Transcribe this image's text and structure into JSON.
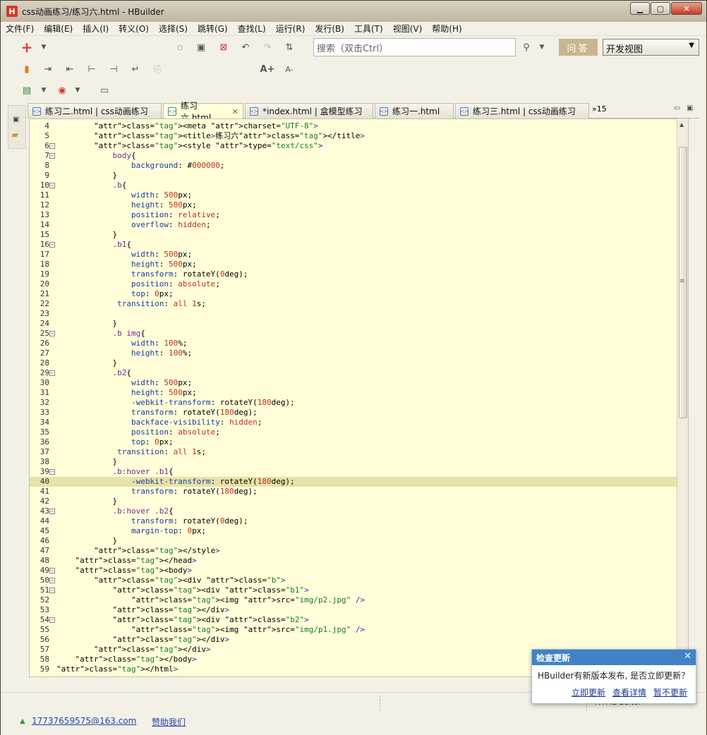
{
  "window": {
    "title": "css动画练习/练习六.html  -  HBuilder",
    "icon_letter": "H"
  },
  "menu": [
    "文件(F)",
    "编辑(E)",
    "插入(I)",
    "转义(O)",
    "选择(S)",
    "跳转(G)",
    "查找(L)",
    "运行(R)",
    "发行(B)",
    "工具(T)",
    "视图(V)",
    "帮助(H)"
  ],
  "toolbar": {
    "search_placeholder": "搜索（双击Ctrl）",
    "ask_label": "问答",
    "view_select": "开发视图",
    "font_increase": "A+",
    "font_decrease": "A-"
  },
  "tabs": [
    {
      "label": "练习二.html | css动画练习",
      "active": false
    },
    {
      "label": "练习六.html",
      "active": true
    },
    {
      "label": "*index.html | 盒模型练习",
      "active": false
    },
    {
      "label": "练习一.html",
      "active": false
    },
    {
      "label": "练习三.html | css动画练习",
      "active": false
    }
  ],
  "tabs_overflow": "»15",
  "editor": {
    "current_line": 40,
    "lines": [
      {
        "n": 4,
        "code": "        <meta charset=\"UTF-8\">"
      },
      {
        "n": 5,
        "code": "        <title>练习六</title>"
      },
      {
        "n": 6,
        "code": "        <style type=\"text/css\">",
        "fold": true
      },
      {
        "n": 7,
        "code": "            body{",
        "fold": true
      },
      {
        "n": 8,
        "code": "                background: #000000;"
      },
      {
        "n": 9,
        "code": "            }"
      },
      {
        "n": 10,
        "code": "            .b{",
        "fold": true
      },
      {
        "n": 11,
        "code": "                width: 500px;"
      },
      {
        "n": 12,
        "code": "                height: 500px;"
      },
      {
        "n": 13,
        "code": "                position: relative;"
      },
      {
        "n": 14,
        "code": "                overflow: hidden;"
      },
      {
        "n": 15,
        "code": "            }"
      },
      {
        "n": 16,
        "code": "            .b1{",
        "fold": true
      },
      {
        "n": 17,
        "code": "                width: 500px;"
      },
      {
        "n": 18,
        "code": "                height: 500px;"
      },
      {
        "n": 19,
        "code": "                transform: rotateY(0deg);"
      },
      {
        "n": 20,
        "code": "                position: absolute;"
      },
      {
        "n": 21,
        "code": "                top: 0px;"
      },
      {
        "n": 22,
        "code": "             transition: all 1s;"
      },
      {
        "n": 23,
        "code": ""
      },
      {
        "n": 24,
        "code": "            }"
      },
      {
        "n": 25,
        "code": "            .b img{",
        "fold": true
      },
      {
        "n": 26,
        "code": "                width: 100%;"
      },
      {
        "n": 27,
        "code": "                height: 100%;"
      },
      {
        "n": 28,
        "code": "            }"
      },
      {
        "n": 29,
        "code": "            .b2{",
        "fold": true
      },
      {
        "n": 30,
        "code": "                width: 500px;"
      },
      {
        "n": 31,
        "code": "                height: 500px;"
      },
      {
        "n": 32,
        "code": "                -webkit-transform: rotateY(180deg);"
      },
      {
        "n": 33,
        "code": "                transform: rotateY(180deg);"
      },
      {
        "n": 34,
        "code": "                backface-visibility: hidden;"
      },
      {
        "n": 35,
        "code": "                position: absolute;"
      },
      {
        "n": 36,
        "code": "                top: 0px;"
      },
      {
        "n": 37,
        "code": "             transition: all 1s;"
      },
      {
        "n": 38,
        "code": "            }"
      },
      {
        "n": 39,
        "code": "            .b:hover .b1{",
        "fold": true
      },
      {
        "n": 40,
        "code": "                -webkit-transform: rotateY(180deg);"
      },
      {
        "n": 41,
        "code": "                transform: rotateY(180deg);"
      },
      {
        "n": 42,
        "code": "            }"
      },
      {
        "n": 43,
        "code": "            .b:hover .b2{",
        "fold": true
      },
      {
        "n": 44,
        "code": "                transform: rotateY(0deg);"
      },
      {
        "n": 45,
        "code": "                margin-top: 0px;"
      },
      {
        "n": 46,
        "code": "            }"
      },
      {
        "n": 47,
        "code": "        </style>"
      },
      {
        "n": 48,
        "code": "    </head>"
      },
      {
        "n": 49,
        "code": "    <body>",
        "fold": true
      },
      {
        "n": 50,
        "code": "        <div class=\"b\">",
        "fold": true
      },
      {
        "n": 51,
        "code": "            <div class=\"b1\">",
        "fold": true
      },
      {
        "n": 52,
        "code": "                <img src=\"img/p2.jpg\" />"
      },
      {
        "n": 53,
        "code": "            </div>"
      },
      {
        "n": 54,
        "code": "            <div class=\"b2\">",
        "fold": true
      },
      {
        "n": 55,
        "code": "                <img src=\"img/p1.jpg\" />"
      },
      {
        "n": 56,
        "code": "            </div>"
      },
      {
        "n": 57,
        "code": "        </div>"
      },
      {
        "n": 58,
        "code": "    </body>"
      },
      {
        "n": 59,
        "code": "</html>"
      }
    ]
  },
  "status": {
    "user_email": "17737659575@163.com",
    "help_link": "赞助我们",
    "mode": "HTML Editor"
  },
  "popup": {
    "title": "检查更新",
    "message": "HBuilder有新版本发布, 是否立即更新？",
    "update_now": "立即更新",
    "view_details": "查看详情",
    "later": "暂不更新"
  }
}
